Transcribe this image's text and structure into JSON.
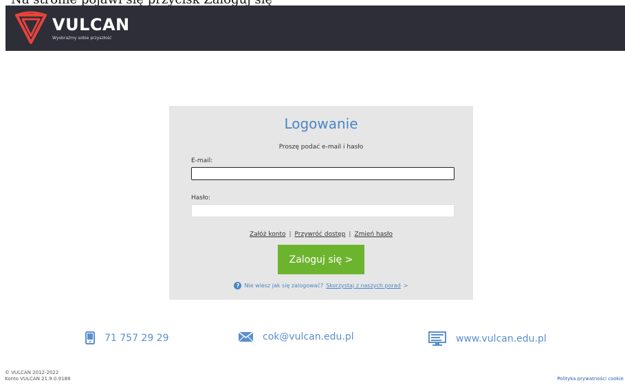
{
  "top_caption": "Na stronie pojawi się przycisk Zaloguj się",
  "header": {
    "brand_name": "VULCAN",
    "slogan": "Wyobraźmy sobie przyszłość",
    "bg_color": "#2e2e38",
    "logo_color": "#e8433b"
  },
  "login": {
    "title": "Logowanie",
    "subtitle": "Proszę podać e-mail i hasło",
    "email_label": "E-mail:",
    "email_value": "",
    "password_label": "Hasło:",
    "password_value": "",
    "links": {
      "create_account": "Załóż konto",
      "restore_access": "Przywróć dostęp",
      "change_password": "Zmień hasło",
      "separator": "|"
    },
    "submit_label": "Zaloguj się >",
    "submit_color": "#6db42e",
    "help_question": "Nie wiesz jak się zalogować?",
    "help_link": "Skorzystaj z naszych porad",
    "help_suffix": ">"
  },
  "contacts": {
    "phone": {
      "icon": "phone-icon",
      "text": "71 757 29 29"
    },
    "email": {
      "icon": "envelope-icon",
      "text": "cok@vulcan.edu.pl"
    },
    "website": {
      "icon": "monitor-icon",
      "text": "www.vulcan.edu.pl"
    },
    "color": "#5a8ecf"
  },
  "footer": {
    "copyright": "© VULCAN 2012-2022",
    "version": "Konto VULCAN 21.9.0.9188",
    "privacy_link": "Polityka prywatności cookie"
  }
}
